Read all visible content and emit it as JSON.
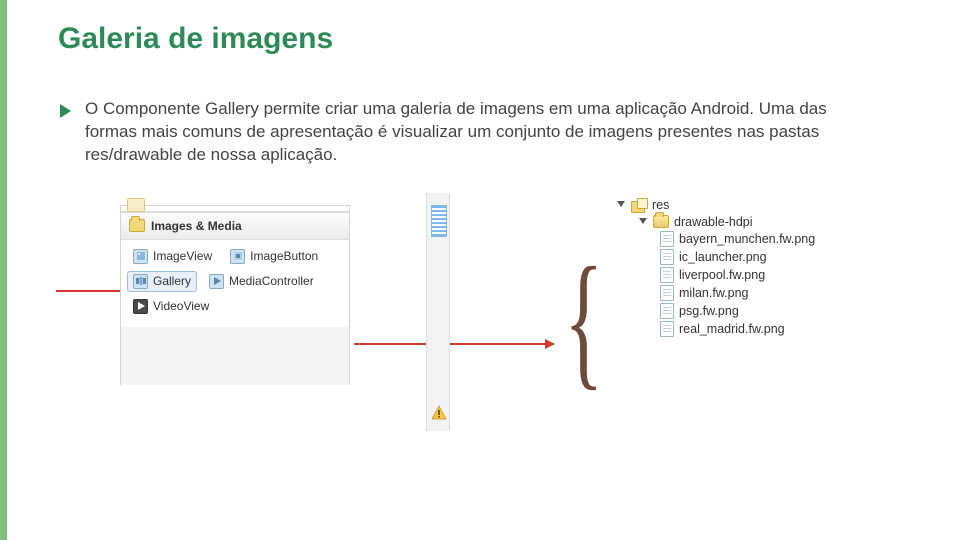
{
  "title": "Galeria de imagens",
  "paragraph": "O Componente Gallery permite criar uma galeria de imagens em uma aplicação Android. Uma das formas mais comuns de apresentação é visualizar um conjunto de imagens presentes nas pastas res/drawable de nossa aplicação.",
  "palette": {
    "group_label": "Images & Media",
    "items": [
      {
        "label": "ImageView"
      },
      {
        "label": "ImageButton"
      },
      {
        "label": "Gallery"
      },
      {
        "label": "MediaController"
      },
      {
        "label": "VideoView"
      }
    ]
  },
  "tree": {
    "root": "res",
    "folder": "drawable-hdpi",
    "files": [
      "bayern_munchen.fw.png",
      "ic_launcher.png",
      "liverpool.fw.png",
      "milan.fw.png",
      "psg.fw.png",
      "real_madrid.fw.png"
    ]
  }
}
